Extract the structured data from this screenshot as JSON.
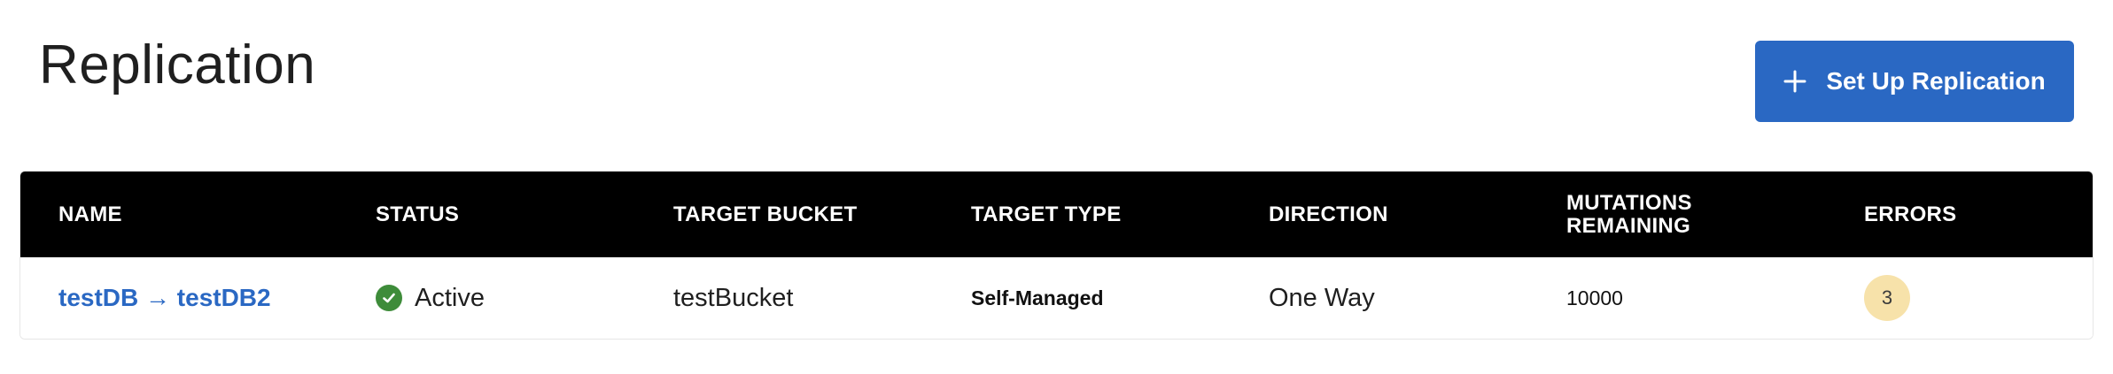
{
  "page": {
    "title": "Replication"
  },
  "toolbar": {
    "setup_label": "Set Up Replication",
    "setup_icon": "plus-icon",
    "accent_color": "#2a68c3"
  },
  "table": {
    "columns": [
      {
        "label": "NAME"
      },
      {
        "label": "STATUS"
      },
      {
        "label": "TARGET BUCKET"
      },
      {
        "label": "TARGET TYPE"
      },
      {
        "label": "DIRECTION"
      },
      {
        "label_line1": "MUTATIONS",
        "label_line2": "REMAINING"
      },
      {
        "label": "ERRORS"
      }
    ],
    "rows": [
      {
        "name": "testDB → testDB2",
        "status": "Active",
        "status_icon": "check-circle-icon",
        "status_color": "#3e8c3a",
        "target_bucket": "testBucket",
        "target_type": "Self-Managed",
        "direction": "One Way",
        "mutations_remaining": "10000",
        "errors": "3",
        "errors_badge_color": "#f7e2aa"
      }
    ]
  }
}
